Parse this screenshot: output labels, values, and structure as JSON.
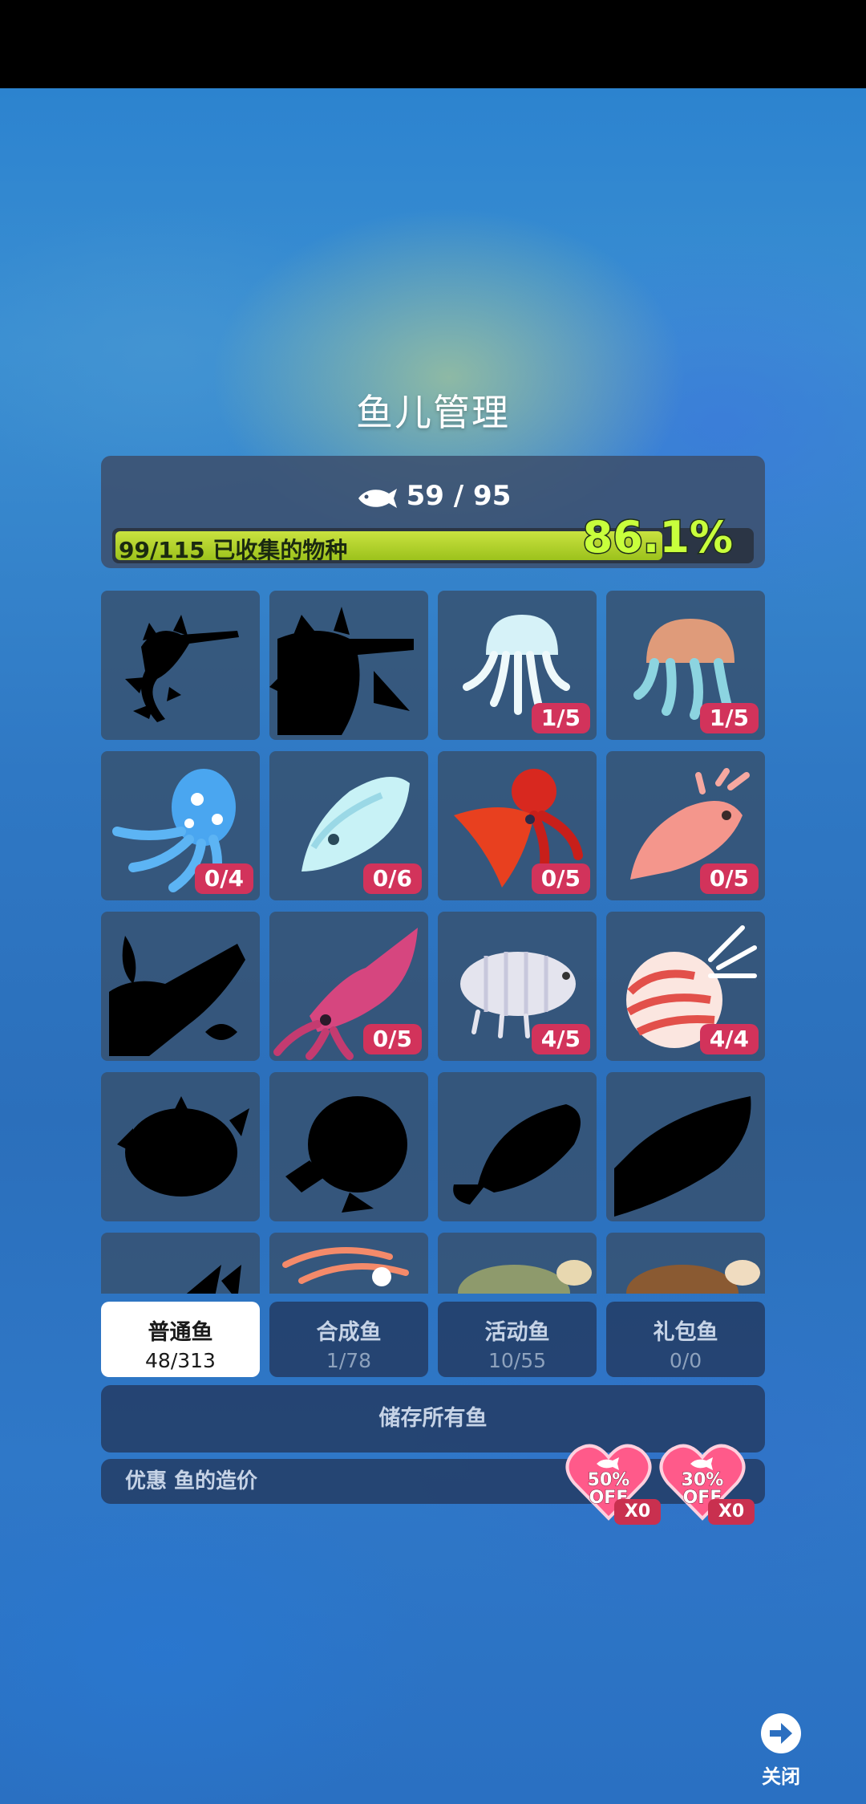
{
  "title": "鱼儿管理",
  "fish_count": "59 / 95",
  "progress": {
    "label": "99/115 已收集的物种",
    "percent": "86.1%",
    "fraction": 0.861
  },
  "grid": [
    {
      "name": "leafy-seadragon",
      "badge": "",
      "silhouette": true
    },
    {
      "name": "weedy-seadragon",
      "badge": "",
      "silhouette": true
    },
    {
      "name": "moon-jellyfish",
      "badge": "1/5",
      "silhouette": false,
      "color": "#d6f2f8"
    },
    {
      "name": "rainbow-jellyfish",
      "badge": "1/5",
      "silhouette": false,
      "color": "#f2a27a"
    },
    {
      "name": "blue-ringed-octopus",
      "badge": "0/4",
      "silhouette": false,
      "color": "#4aa6f0"
    },
    {
      "name": "cuttlefish",
      "badge": "0/6",
      "silhouette": false,
      "color": "#c8f2f6"
    },
    {
      "name": "dumbo-octopus",
      "badge": "0/5",
      "silhouette": false,
      "color": "#d8281f"
    },
    {
      "name": "pink-shrimp",
      "badge": "0/5",
      "silhouette": false,
      "color": "#f4968c"
    },
    {
      "name": "squid-silhouette",
      "badge": "",
      "silhouette": true
    },
    {
      "name": "pink-squid",
      "badge": "0/5",
      "silhouette": false,
      "color": "#d6467f"
    },
    {
      "name": "isopod",
      "badge": "4/5",
      "silhouette": false,
      "color": "#e4e4ee"
    },
    {
      "name": "nautilus",
      "badge": "4/4",
      "silhouette": false,
      "color": "#f08a8a"
    },
    {
      "name": "pufferfish-silhouette",
      "badge": "",
      "silhouette": true
    },
    {
      "name": "frogfish-silhouette",
      "badge": "",
      "silhouette": true
    },
    {
      "name": "grouper-silhouette",
      "badge": "",
      "silhouette": true
    },
    {
      "name": "coelacanth-silhouette",
      "badge": "",
      "silhouette": true
    },
    {
      "name": "shark-silhouette",
      "badge": "",
      "silhouette": true
    },
    {
      "name": "giant-squid",
      "badge": "",
      "silhouette": false,
      "color": "#f48a6a"
    },
    {
      "name": "green-sea-turtle",
      "badge": "",
      "silhouette": false,
      "color": "#8e9a6c"
    },
    {
      "name": "loggerhead-turtle",
      "badge": "",
      "silhouette": false,
      "color": "#8a5a32"
    }
  ],
  "tabs": [
    {
      "label": "普通鱼",
      "count": "48/313",
      "active": true
    },
    {
      "label": "合成鱼",
      "count": "1/78",
      "active": false
    },
    {
      "label": "活动鱼",
      "count": "10/55",
      "active": false
    },
    {
      "label": "礼包鱼",
      "count": "0/0",
      "active": false
    }
  ],
  "store_all_label": "储存所有鱼",
  "discount": {
    "label": "优惠 鱼的造价",
    "coupons": [
      {
        "percent": "50%",
        "off": "OFF",
        "qty": "X0"
      },
      {
        "percent": "30%",
        "off": "OFF",
        "qty": "X0"
      }
    ]
  },
  "close_label": "关闭",
  "icons": {
    "fish": "fish-icon",
    "close": "arrow-right-circle-icon",
    "heart": "heart-coupon-icon"
  },
  "colors": {
    "progress_fill": "#b5d52a",
    "badge": "#d2335b",
    "percent_text": "#c8ff3c"
  }
}
